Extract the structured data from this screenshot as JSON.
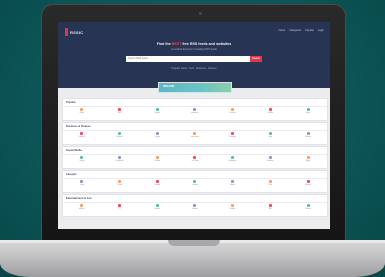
{
  "site": {
    "logo": "RSSIC",
    "nav": [
      "Home",
      "Categories",
      "Popular",
      "Login"
    ],
    "hero_title_pre": "Find the",
    "hero_title_accent": "BEST",
    "hero_title_post": "free RSS feeds and websites",
    "hero_subtitle": "A curated directory of quality RSS feeds",
    "search_placeholder": "Search RSS feeds...",
    "search_button": "Search",
    "hero_links": "Popular: News · Tech · Business · Science",
    "banner": "RSS.COM"
  },
  "colors": {
    "hero": "#273454",
    "accent": "#e2394a",
    "icon_palette": [
      "#f1a36b",
      "#e0535f",
      "#69b9a7",
      "#8f9cb8"
    ]
  },
  "sections": [
    {
      "title": "Popular",
      "items": [
        "News",
        "Tech",
        "Sports",
        "Business",
        "Science",
        "Games",
        "Music"
      ]
    },
    {
      "title": "Business & Finance",
      "items": [
        "Finance",
        "Markets",
        "Crypto",
        "Economy",
        "Startups",
        "Jobs",
        "Money"
      ]
    },
    {
      "title": "Social Media",
      "items": [
        "Twitter",
        "Facebook",
        "Reddit",
        "YouTube",
        "Instagram",
        "Medium",
        "Blogs"
      ]
    },
    {
      "title": "Lifestyle",
      "items": [
        "Food",
        "Travel",
        "Health",
        "Fashion",
        "Home",
        "Pets",
        "Fitness"
      ]
    },
    {
      "title": "Entertainment & Fun",
      "items": [
        "Movies",
        "TV",
        "Comics",
        "Humor",
        "Books",
        "Art",
        "Photos"
      ]
    }
  ]
}
